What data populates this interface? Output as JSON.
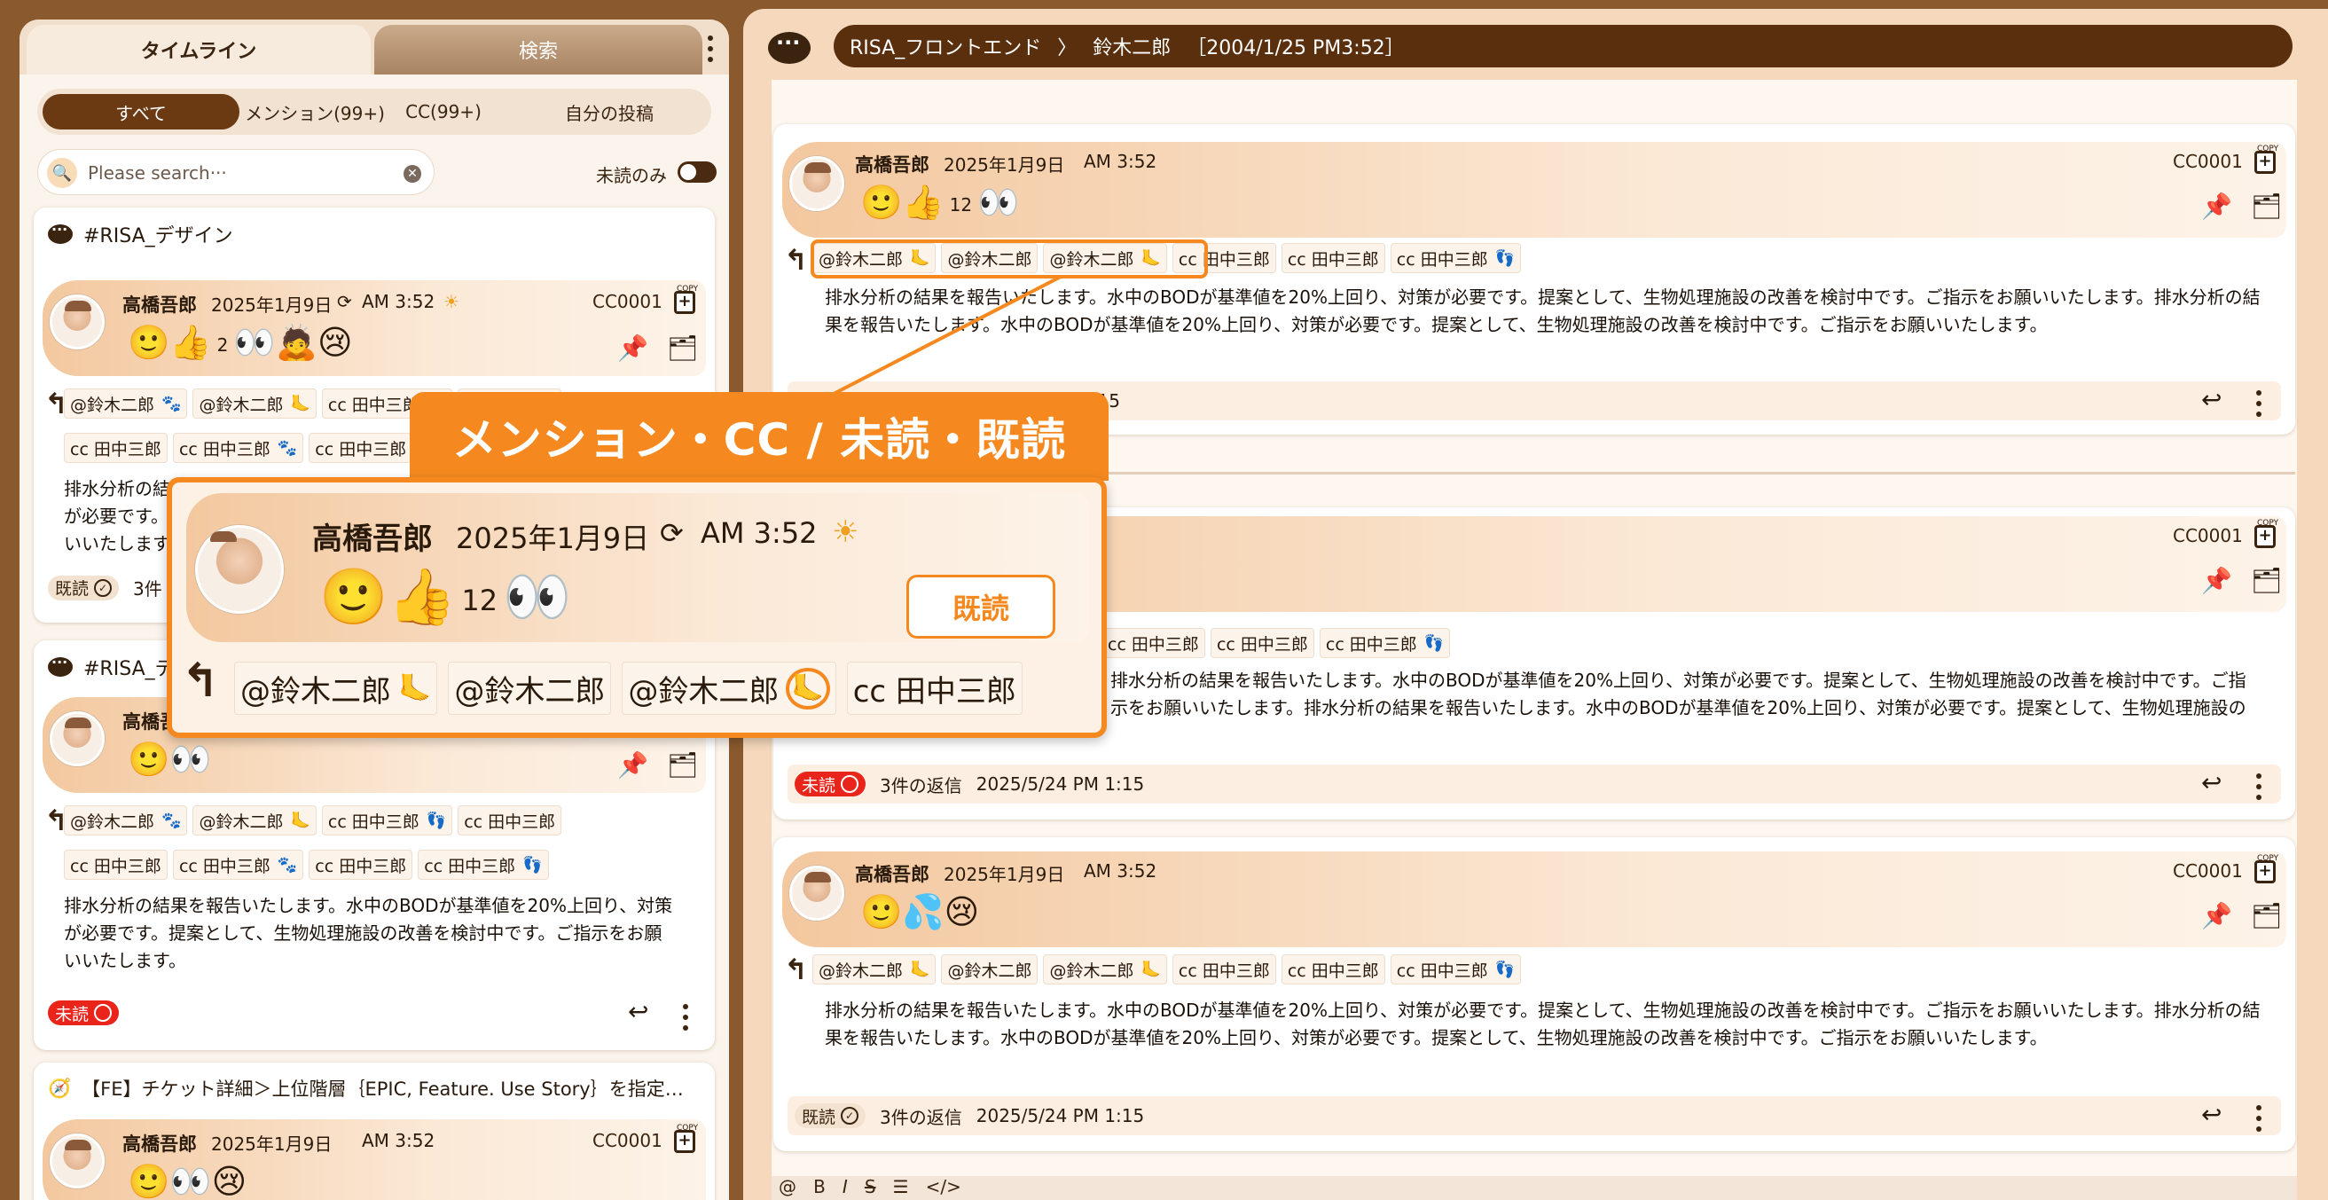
{
  "left_panel": {
    "tabs": [
      "タイムライン",
      "検索"
    ],
    "filters": [
      "すべて",
      "メンション(99+)",
      "CC(99+)",
      "自分の投稿"
    ],
    "search_placeholder": "Please search···",
    "unread_only": "未読のみ"
  },
  "post_common": {
    "author": "高橋吾郎",
    "date": "2025年1月9日",
    "time": "AM 3:52",
    "id": "CC0001",
    "copy": "COPY",
    "mentions": [
      "@鈴木二郎",
      "@鈴木二郎",
      "@鈴木二郎",
      "cc 田中三郎",
      "cc 田中三郎",
      "cc 田中三郎"
    ],
    "cc_row": [
      "cc 田中三郎",
      "cc 田中三郎",
      "cc 田中三郎",
      "cc 田中三郎"
    ],
    "body_left": "排水分析の結果を報告いたします。水中のBODが基準値を20%上回り、対策が必要です。提案として、生物処理施設の改善を検討中です。ご指示をお願いいたします。",
    "body_right": "排水分析の結果を報告いたします。水中のBODが基準値を20%上回り、対策が必要です。提案として、生物処理施設の改善を検討中です。ご指示をお願いいたします。排水分析の結果を報告いたします。水中のBODが基準値を20%上回り、対策が必要です。提案として、生物処理施設の改善を検討中です。ご指示をお願いいたします。",
    "read": "既読",
    "unread": "未読",
    "replies": "3件の返信",
    "reply_time": "2025/5/24 PM 1:15",
    "reply_short": "3件"
  },
  "left_cards": [
    {
      "channel": "#RISA_デザイン",
      "reaction_count": "2"
    },
    {
      "channel": "#RISA_デ"
    },
    {
      "channel": "【FE】チケット詳細＞上位階層｛EPIC, Feature. Use Story｝を指定…"
    }
  ],
  "right_panel": {
    "breadcrumb_channel": "RISA_フロントエンド",
    "breadcrumb_sep": "〉",
    "breadcrumb_user": "鈴木二郎",
    "breadcrumb_time": "［2004/1/25 PM3:52］",
    "reaction_count": "12",
    "partial_time": "1:15"
  },
  "callout": {
    "title": "メンション・CC / 未読・既読",
    "kidoku": "既読",
    "count": "12",
    "tags": [
      "@鈴木二郎",
      "@鈴木二郎",
      "@鈴木二郎",
      "cc 田中三郎"
    ]
  },
  "colors": {
    "brand": "#5a2f0e",
    "accent": "#f5891f",
    "unread": "#e8241b"
  }
}
